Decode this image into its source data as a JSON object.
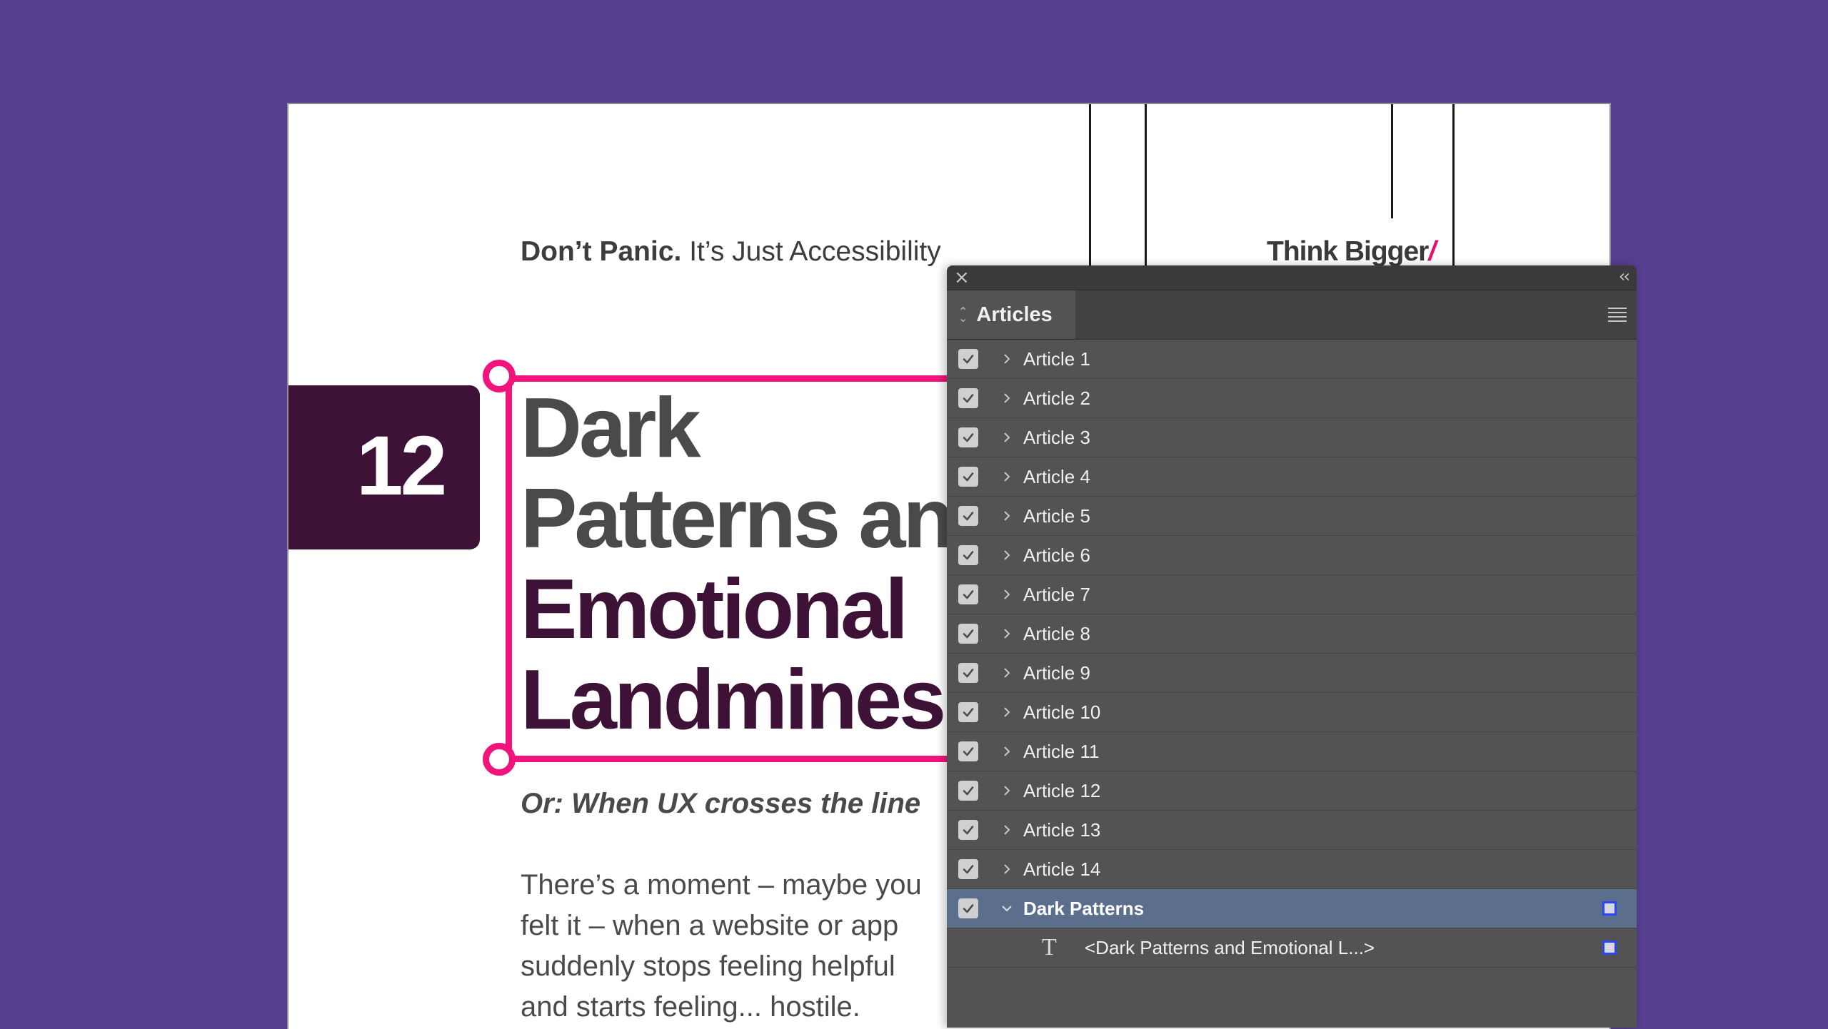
{
  "document": {
    "running_header_bold": "Don’t Panic.",
    "running_header_rest": " It’s Just Accessibility",
    "brand_text": "Think Bigger",
    "brand_slash": "/",
    "chapter_number": "12",
    "headline_lines": [
      "Dark",
      "Patterns an",
      "Emotional",
      "Landmines"
    ],
    "subtitle": "Or: When UX crosses the line",
    "body_lines": [
      "There’s a moment – maybe you",
      "felt it – when a website or app",
      "suddenly stops feeling helpful",
      "and starts feeling... hostile."
    ]
  },
  "panel": {
    "close_icon": "×",
    "collapse_icon": "‹‹",
    "tab_label": "Articles",
    "articles": [
      {
        "label": "Article 1",
        "checked": true,
        "expanded": false
      },
      {
        "label": "Article 2",
        "checked": true,
        "expanded": false
      },
      {
        "label": "Article 3",
        "checked": true,
        "expanded": false
      },
      {
        "label": "Article 4",
        "checked": true,
        "expanded": false
      },
      {
        "label": "Article 5",
        "checked": true,
        "expanded": false
      },
      {
        "label": "Article 6",
        "checked": true,
        "expanded": false
      },
      {
        "label": "Article 7",
        "checked": true,
        "expanded": false
      },
      {
        "label": "Article 8",
        "checked": true,
        "expanded": false
      },
      {
        "label": "Article 9",
        "checked": true,
        "expanded": false
      },
      {
        "label": "Article 10",
        "checked": true,
        "expanded": false
      },
      {
        "label": "Article 11",
        "checked": true,
        "expanded": false
      },
      {
        "label": "Article 12",
        "checked": true,
        "expanded": false
      },
      {
        "label": "Article 13",
        "checked": true,
        "expanded": false
      },
      {
        "label": "Article 14",
        "checked": true,
        "expanded": false
      },
      {
        "label": "Dark Patterns",
        "checked": true,
        "expanded": true,
        "selected": true
      }
    ],
    "child_item": {
      "icon": "T",
      "label": "<Dark Patterns and Emotional L...>"
    }
  },
  "colors": {
    "background": "#563f8f",
    "accent_pink": "#f0147c",
    "plum": "#3e1236",
    "panel_bg": "#535353",
    "selection": "#5b6f8d"
  }
}
